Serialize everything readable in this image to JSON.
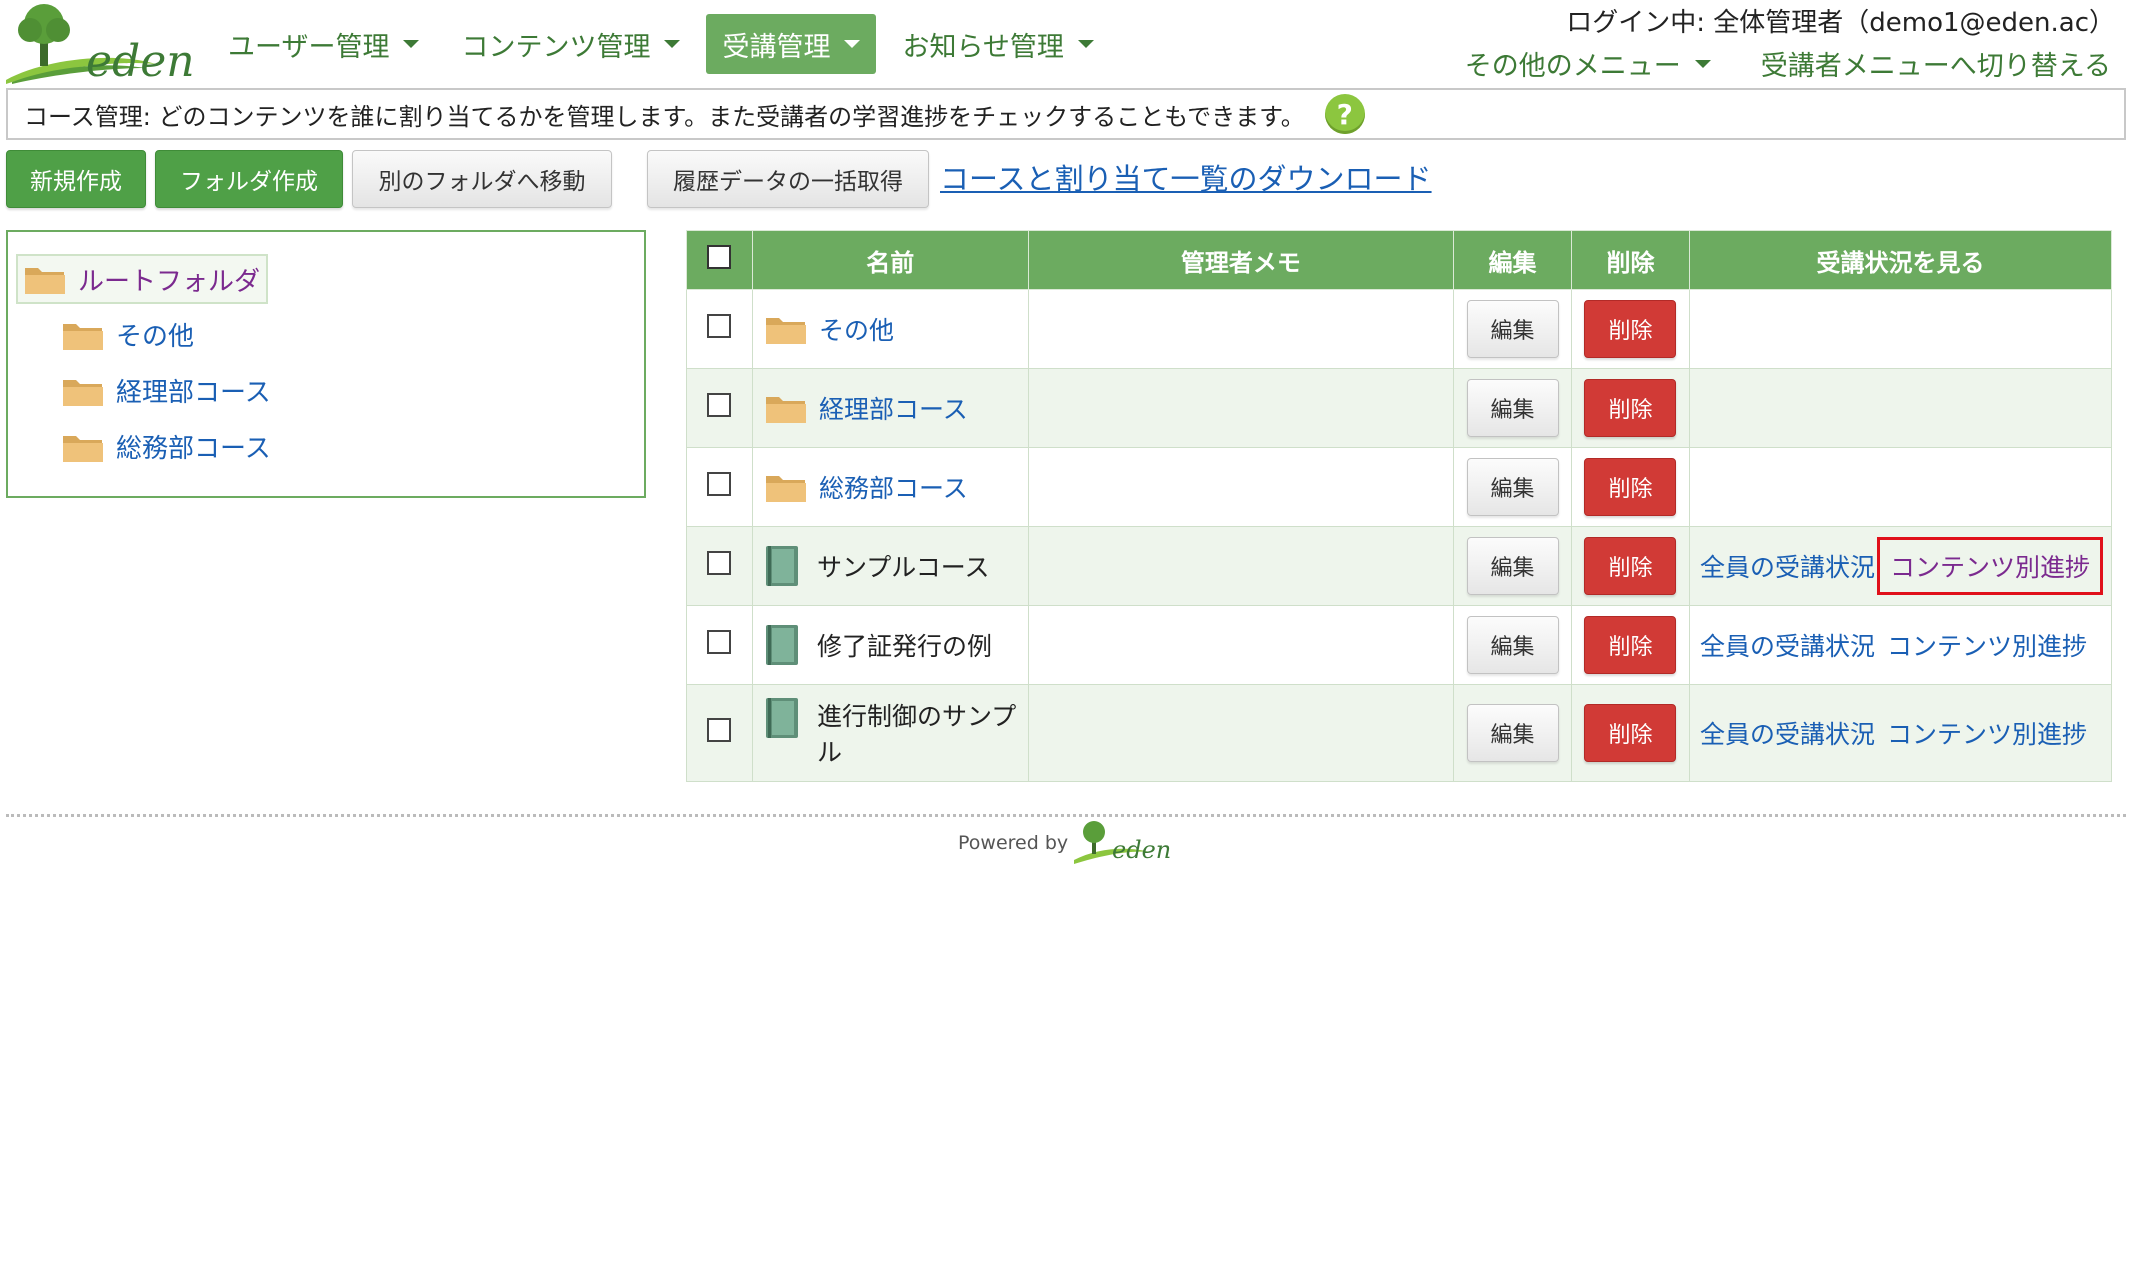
{
  "header": {
    "logo_text": "eden",
    "nav": [
      {
        "label": "ユーザー管理"
      },
      {
        "label": "コンテンツ管理"
      },
      {
        "label": "受講管理"
      },
      {
        "label": "お知らせ管理"
      }
    ],
    "login_info": "ログイン中: 全体管理者（demo1@eden.ac）",
    "other_menu_label": "その他のメニュー",
    "switch_menu_label": "受講者メニューへ切り替える"
  },
  "infobar": {
    "text": "コース管理: どのコンテンツを誰に割り当てるかを管理します。また受講者の学習進捗をチェックすることもできます。",
    "help_symbol": "?"
  },
  "toolbar": {
    "new_label": "新規作成",
    "folder_label": "フォルダ作成",
    "move_label": "別のフォルダへ移動",
    "history_label": "履歴データの一括取得",
    "download_link": "コースと割り当て一覧のダウンロード"
  },
  "tree": {
    "root": "ルートフォルダ",
    "children": [
      "その他",
      "経理部コース",
      "総務部コース"
    ]
  },
  "table": {
    "headers": {
      "name": "名前",
      "memo": "管理者メモ",
      "edit": "編集",
      "delete": "削除",
      "status": "受講状況を見る"
    },
    "rows": [
      {
        "type": "folder",
        "name": "その他",
        "memo": ""
      },
      {
        "type": "folder",
        "name": "経理部コース",
        "memo": ""
      },
      {
        "type": "folder",
        "name": "総務部コース",
        "memo": ""
      },
      {
        "type": "course",
        "name": "サンプルコース",
        "memo": ""
      },
      {
        "type": "course",
        "name": "修了証発行の例",
        "memo": ""
      },
      {
        "type": "course",
        "name": "進行制御のサンプル",
        "memo": ""
      }
    ],
    "edit_label": "編集",
    "delete_label": "削除",
    "all_status_link": "全員の受講状況",
    "content_progress_link": "コンテンツ別進捗"
  },
  "footer": {
    "powered_by": "Powered by",
    "logo_text": "eden"
  },
  "colors": {
    "brand_green": "#6cab60",
    "button_green": "#4fa047",
    "delete_red": "#d13a36",
    "link_blue": "#1a5fb4",
    "visited_purple": "#7b2a8f",
    "highlight_red": "#e0101a"
  }
}
